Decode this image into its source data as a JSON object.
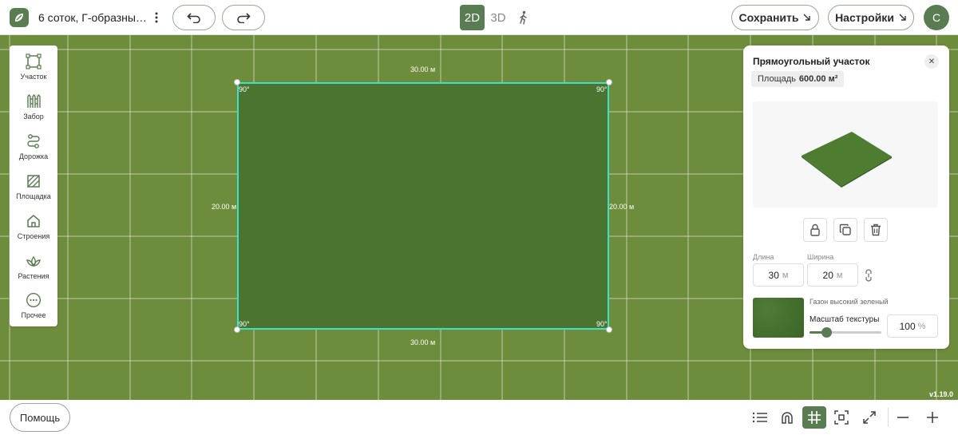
{
  "header": {
    "project_title": "6 соток, Г-образны…",
    "mode_2d": "2D",
    "mode_3d": "3D",
    "save_label": "Сохранить",
    "settings_label": "Настройки",
    "avatar_letter": "С"
  },
  "toolbar": {
    "items": [
      {
        "label": "Участок",
        "icon": "plot-icon"
      },
      {
        "label": "Забор",
        "icon": "fence-icon"
      },
      {
        "label": "Дорожка",
        "icon": "path-icon"
      },
      {
        "label": "Площадка",
        "icon": "area-icon"
      },
      {
        "label": "Строения",
        "icon": "house-icon"
      },
      {
        "label": "Растения",
        "icon": "plant-icon"
      },
      {
        "label": "Прочее",
        "icon": "more-icon"
      }
    ]
  },
  "canvas": {
    "top_dimension": "30.00 м",
    "bottom_dimension": "30.00 м",
    "left_dimension": "20.00 м",
    "right_dimension": "20.00 м",
    "angles": [
      "90°",
      "90°",
      "90°",
      "90°"
    ],
    "plot_color": "#4a7430",
    "outline_color": "#3fe0c8"
  },
  "panel": {
    "title": "Прямоугольный участок",
    "area_label": "Площадь",
    "area_value": "600.00 м²",
    "length_label": "Длина",
    "length_value": "30",
    "length_unit": "м",
    "width_label": "Ширина",
    "width_value": "20",
    "width_unit": "м",
    "texture_name": "Газон высокий зеленый",
    "texture_scale_label": "Масштаб текстуры",
    "texture_scale_value": "100",
    "texture_scale_unit": "%",
    "texture_scale_fraction": 0.23
  },
  "version": "v1.19.0",
  "bottom": {
    "help_label": "Помощь"
  },
  "colors": {
    "accent": "#5a7c52",
    "canvas_bg": "#6e8d3c"
  }
}
